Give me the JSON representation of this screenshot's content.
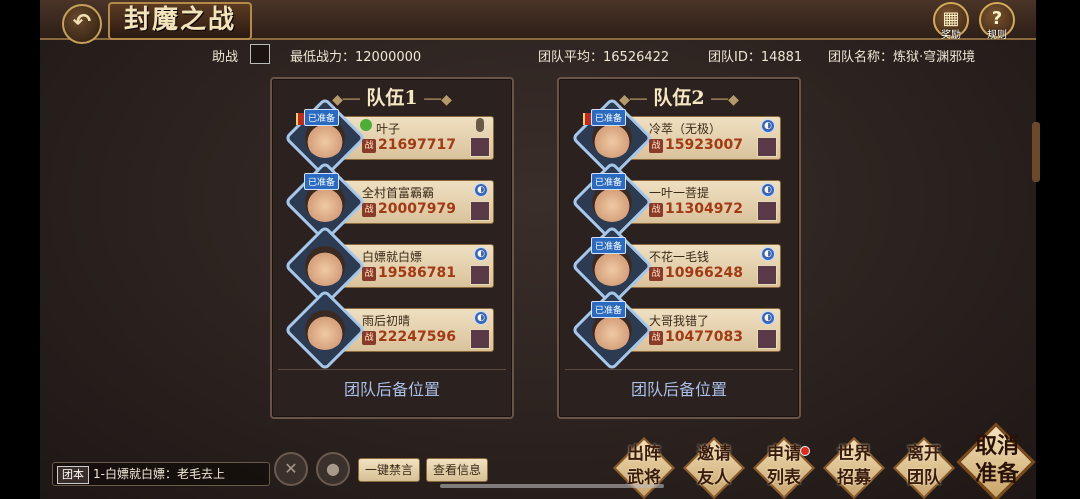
{
  "header": {
    "title": "封魔之战",
    "back_icon": "back-arrow-icon",
    "reward_label": "奖励",
    "rules_label": "规则",
    "reward_icon": "gift-icon",
    "rules_icon": "question-icon"
  },
  "info": {
    "assist_label": "助战",
    "min_power": "最低战力：12000000",
    "team_avg": "团队平均：16526422",
    "team_id": "团队ID：14881",
    "team_name": "团队名称：炼狱·穹渊邪境"
  },
  "teams": [
    {
      "title": "队伍1",
      "reserve": "团队后备位置",
      "members": [
        {
          "name": "叶子",
          "power": "21697717",
          "ready": "已准备",
          "leader": true
        },
        {
          "name": "全村首富霸霸",
          "power": "20007979",
          "ready": "已准备"
        },
        {
          "name": "白嫖就白嫖",
          "power": "19586781",
          "ready": ""
        },
        {
          "name": "雨后初晴",
          "power": "22247596",
          "ready": ""
        }
      ]
    },
    {
      "title": "队伍2",
      "reserve": "团队后备位置",
      "members": [
        {
          "name": "冷萃（无极）",
          "power": "15923007",
          "ready": "已准备"
        },
        {
          "name": "一叶一菩提",
          "power": "11304972",
          "ready": "已准备"
        },
        {
          "name": "不花一毛钱",
          "power": "10966248",
          "ready": "已准备"
        },
        {
          "name": "大哥我错了",
          "power": "10477083",
          "ready": "已准备"
        }
      ]
    }
  ],
  "power_label": "战",
  "bottom": {
    "chat_tag": "团本",
    "chat_text": "1-白嫖就白嫖：老毛去上",
    "mute_all": "一键禁言",
    "view_info": "查看信息",
    "buttons": [
      "出阵\n武将",
      "邀请\n友人",
      "申请\n列表",
      "世界\n招募",
      "离开\n团队"
    ],
    "cancel_ready": "取消\n准备"
  }
}
